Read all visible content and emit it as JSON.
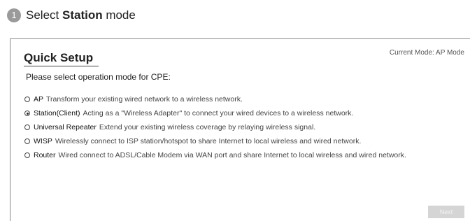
{
  "step": {
    "number": "1",
    "prefix": "Select ",
    "mode_word": "Station",
    "suffix": " mode"
  },
  "panel": {
    "title": "Quick Setup",
    "current_mode": "Current Mode: AP Mode",
    "prompt": "Please select operation mode for CPE:"
  },
  "modes": [
    {
      "name": "AP",
      "description": "Transform your existing wired network to a wireless network.",
      "selected": false
    },
    {
      "name": "Station(Client)",
      "description": "Acting as a \"Wireless Adapter\" to connect your wired devices to a wireless network.",
      "selected": true
    },
    {
      "name": "Universal Repeater",
      "description": "Extend your existing wireless coverage by relaying wireless signal.",
      "selected": false
    },
    {
      "name": "WISP",
      "description": "Wirelessly connect to ISP station/hotspot to share Internet to local wireless and wired network.",
      "selected": false
    },
    {
      "name": "Router",
      "description": "Wired connect to ADSL/Cable Modem via WAN port and share Internet to local wireless and wired network.",
      "selected": false
    }
  ],
  "next_label": "Next"
}
